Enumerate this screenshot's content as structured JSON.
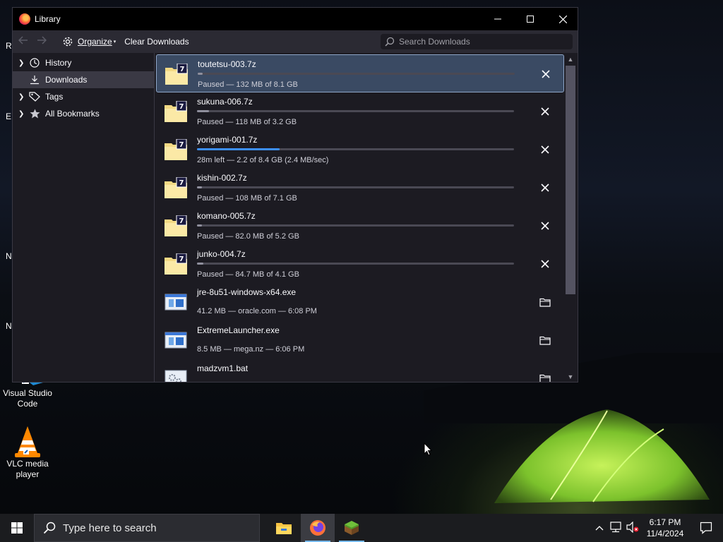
{
  "window": {
    "title": "Library",
    "controls": {
      "minimize": "—",
      "maximize": "☐",
      "close": "✕"
    }
  },
  "toolbar": {
    "organize_label": "Organize",
    "clear_label": "Clear Downloads",
    "search_placeholder": "Search Downloads"
  },
  "sidebar": {
    "items": [
      {
        "label": "History",
        "icon": "clock-icon"
      },
      {
        "label": "Downloads",
        "icon": "download-icon"
      },
      {
        "label": "Tags",
        "icon": "tag-icon"
      },
      {
        "label": "All Bookmarks",
        "icon": "star-icon"
      }
    ]
  },
  "downloads": [
    {
      "name": "toutetsu-003.7z",
      "status": "Paused — 132 MB of 8.1 GB",
      "progress": 0.016,
      "active": false,
      "icon": "7z-archive-icon",
      "action": "cancel-icon"
    },
    {
      "name": "sukuna-006.7z",
      "status": "Paused — 118 MB of 3.2 GB",
      "progress": 0.037,
      "active": false,
      "icon": "7z-archive-icon",
      "action": "cancel-icon"
    },
    {
      "name": "yorigami-001.7z",
      "status": "28m left — 2.2 of 8.4 GB (2.4 MB/sec)",
      "progress": 0.26,
      "active": true,
      "icon": "7z-archive-icon",
      "action": "cancel-icon"
    },
    {
      "name": "kishin-002.7z",
      "status": "Paused — 108 MB of 7.1 GB",
      "progress": 0.015,
      "active": false,
      "icon": "7z-archive-icon",
      "action": "cancel-icon"
    },
    {
      "name": "komano-005.7z",
      "status": "Paused — 82.0 MB of 5.2 GB",
      "progress": 0.016,
      "active": false,
      "icon": "7z-archive-icon",
      "action": "cancel-icon"
    },
    {
      "name": "junko-004.7z",
      "status": "Paused — 84.7 MB of 4.1 GB",
      "progress": 0.021,
      "active": false,
      "icon": "7z-archive-icon",
      "action": "cancel-icon"
    },
    {
      "name": "jre-8u51-windows-x64.exe",
      "status": "41.2 MB — oracle.com — 6:08 PM",
      "icon": "exe-icon",
      "action": "folder-icon"
    },
    {
      "name": "ExtremeLauncher.exe",
      "status": "8.5 MB — mega.nz — 6:06 PM",
      "icon": "exe-icon",
      "action": "folder-icon"
    },
    {
      "name": "madzvm1.bat",
      "status": "",
      "icon": "bat-icon",
      "action": "folder-icon"
    }
  ],
  "desktop": {
    "icons": [
      {
        "label": "Visual Studio Code"
      },
      {
        "label": "VLC media player"
      }
    ],
    "edge_fragments": [
      "R",
      "E",
      "N",
      "N"
    ]
  },
  "taskbar": {
    "search_placeholder": "Type here to search",
    "time": "6:17 PM",
    "date": "11/4/2024"
  },
  "colors": {
    "accent": "#3d8ff5",
    "window_bg": "#1c1b22",
    "toolbar_bg": "#2b2a33"
  }
}
